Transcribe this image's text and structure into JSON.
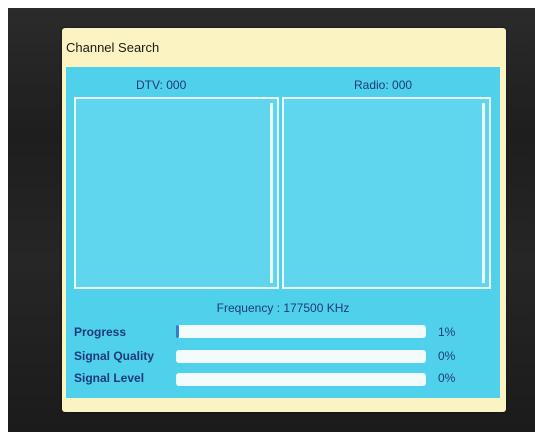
{
  "dialog": {
    "title": "Channel Search",
    "dtv_count": "DTV: 000",
    "radio_count": "Radio: 000",
    "frequency": "Frequency : 177500 KHz"
  },
  "meters": [
    {
      "label": "Progress",
      "value": "1%",
      "fraction": 0.01
    },
    {
      "label": "Signal Quality",
      "value": "0%",
      "fraction": 0
    },
    {
      "label": "Signal Level",
      "value": "0%",
      "fraction": 0
    }
  ],
  "colors": {
    "panel": "#fbf4c2",
    "content": "#4fd1ec",
    "text": "#1f3a7a",
    "track": "#f4fbfd"
  }
}
